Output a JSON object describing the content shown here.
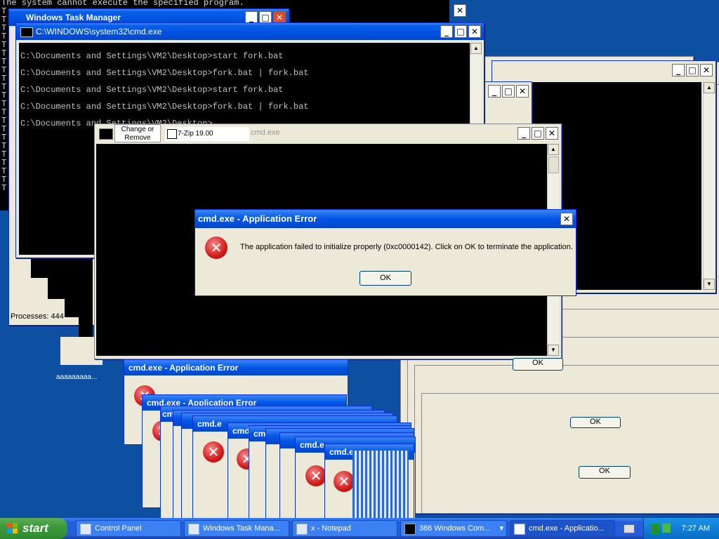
{
  "top_console": {
    "line": "The system cannot execute the specified program.",
    "prefix_char": "T"
  },
  "task_manager": {
    "title": "Windows Task Manager",
    "processes_label": "Processes: 444"
  },
  "cmd_main": {
    "title": "C:\\WINDOWS\\system32\\cmd.exe",
    "lines": [
      "C:\\Documents and Settings\\VM2\\Desktop>start fork.bat",
      "C:\\Documents and Settings\\VM2\\Desktop>fork.bat | fork.bat",
      "C:\\Documents and Settings\\VM2\\Desktop>start fork.bat",
      "C:\\Documents and Settings\\VM2\\Desktop>fork.bat | fork.bat",
      "C:\\Documents and Settings\\VM2\\Desktop>"
    ]
  },
  "cmd_front": {
    "title": "cmd.exe",
    "change_remove_label": "Change or Remove",
    "zip_label": "7-Zip 19.00"
  },
  "error_main": {
    "title": "cmd.exe - Application Error",
    "message": "The application failed to initialize properly (0xc0000142). Click on OK to terminate the application.",
    "ok_label": "OK"
  },
  "error_stack": {
    "title": "cmd.exe - Application Error",
    "ok_label": "OK",
    "short_title": "cmd.e"
  },
  "notepad_text": "aaaaaaaaa...",
  "taskbar": {
    "start_label": "start",
    "items": [
      {
        "label": "Control Panel"
      },
      {
        "label": "Windows Task Mana..."
      },
      {
        "label": "x - Notepad"
      },
      {
        "label": "386 Windows Com...",
        "count": "386"
      },
      {
        "label": "cmd.exe - Applicatio..."
      }
    ],
    "clock": "7:27 AM"
  },
  "icons": {
    "close": "✕",
    "minimize": "_",
    "maximize": "□",
    "error": "✕",
    "scroll_up": "▲",
    "scroll_down": "▼"
  }
}
